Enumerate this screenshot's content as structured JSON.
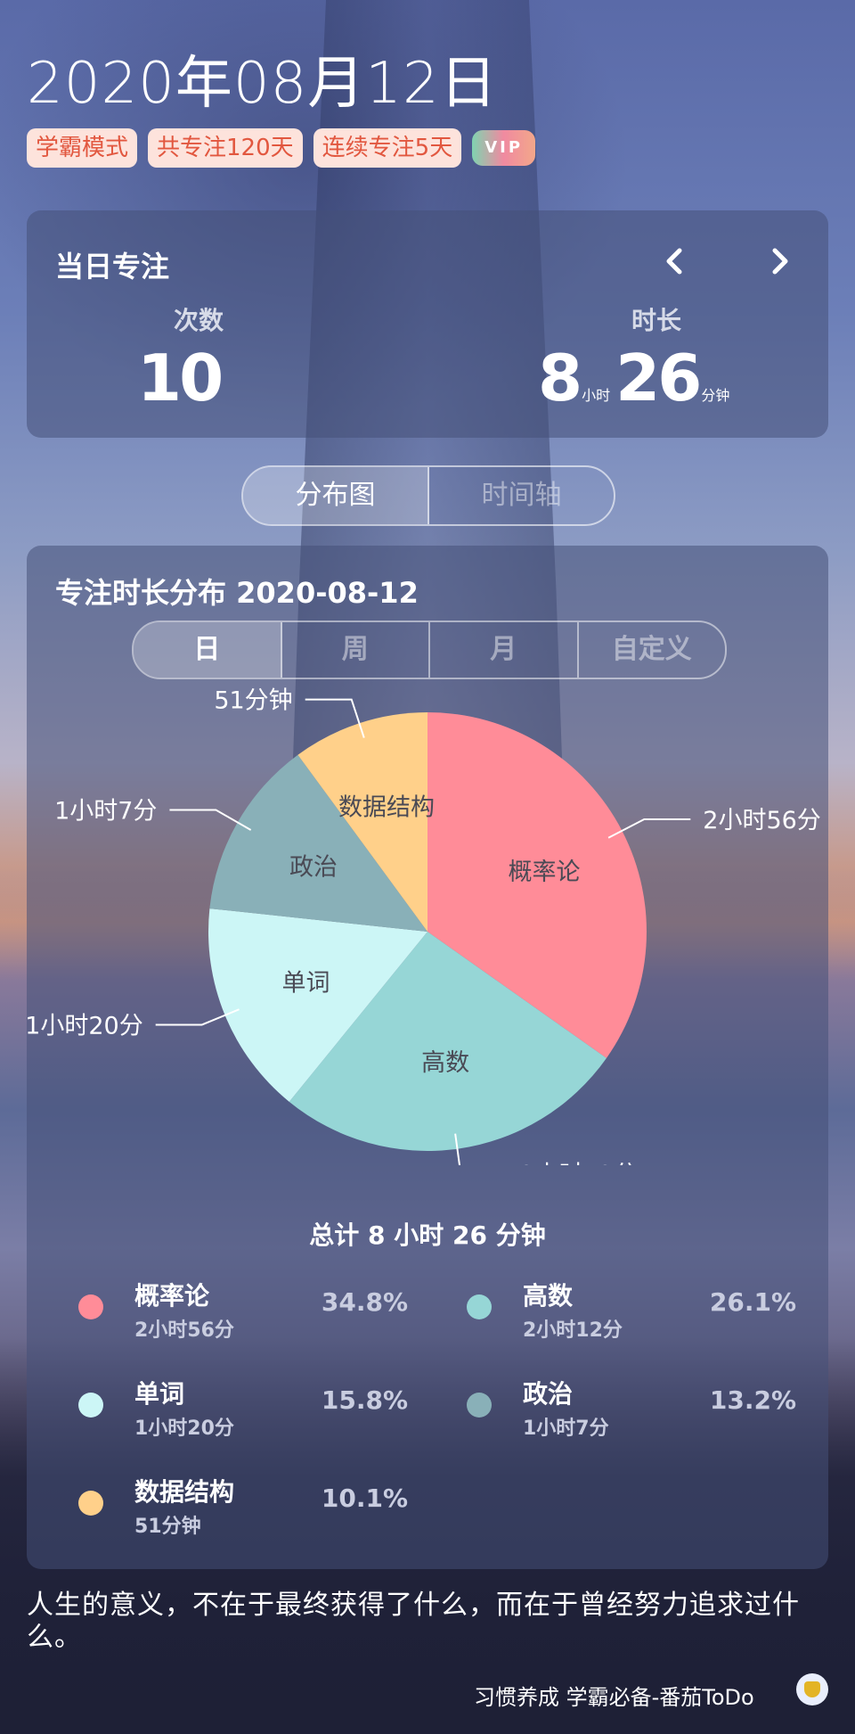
{
  "header": {
    "date": "2020年08月12日",
    "tags": [
      "学霸模式",
      "共专注120天",
      "连续专注5天"
    ],
    "vip": "VIP"
  },
  "daily": {
    "title": "当日专注",
    "count_label": "次数",
    "count_value": "10",
    "duration_label": "时长",
    "hours": "8",
    "hours_unit": "小时",
    "minutes": "26",
    "minutes_unit": "分钟"
  },
  "view_switch": {
    "distribution": "分布图",
    "timeline": "时间轴"
  },
  "distribution": {
    "title": "专注时长分布  2020-08-12",
    "periods": [
      "日",
      "周",
      "月",
      "自定义"
    ],
    "total": "总计 8 小时 26 分钟"
  },
  "chart_data": {
    "type": "pie",
    "slices": [
      {
        "name": "概率论",
        "minutes": 176,
        "label": "2小时56分",
        "percent": "34.8%",
        "color": "#ff8c98"
      },
      {
        "name": "高数",
        "minutes": 132,
        "label": "2小时12分",
        "percent": "26.1%",
        "color": "#96d6d6"
      },
      {
        "name": "单词",
        "minutes": 80,
        "label": "1小时20分",
        "percent": "15.8%",
        "color": "#ccf6f6"
      },
      {
        "name": "政治",
        "minutes": 67,
        "label": "1小时7分",
        "percent": "13.2%",
        "color": "#89b0b8"
      },
      {
        "name": "数据结构",
        "minutes": 51,
        "label": "51分钟",
        "percent": "10.1%",
        "color": "#ffd08a"
      }
    ]
  },
  "quote": "人生的意义，不在于最终获得了什么，而在于曾经努力追求过什么。",
  "footer": "习惯养成 学霸必备-番茄ToDo"
}
